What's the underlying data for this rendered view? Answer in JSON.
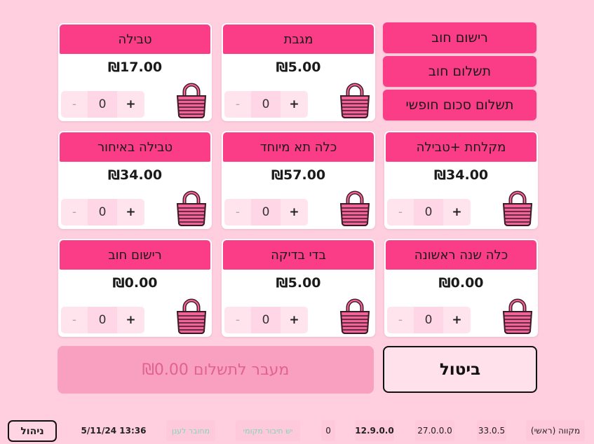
{
  "actions": [
    {
      "label": "רישום חוב"
    },
    {
      "label": "תשלום חוב"
    },
    {
      "label": "תשלום סכום חופשי"
    }
  ],
  "products": [
    {
      "title": "טבילה",
      "price": "₪17.00",
      "qty": "0"
    },
    {
      "title": "מגבת",
      "price": "₪5.00",
      "qty": "0"
    },
    {
      "title": "טבילה באיחור",
      "price": "₪34.00",
      "qty": "0"
    },
    {
      "title": "כלה תא מיוחד",
      "price": "₪57.00",
      "qty": "0"
    },
    {
      "title": "מקלחת +טבילה",
      "price": "₪34.00",
      "qty": "0"
    },
    {
      "title": "רישום חוב",
      "price": "₪0.00",
      "qty": "0"
    },
    {
      "title": "בדי בדיקה",
      "price": "₪5.00",
      "qty": "0"
    },
    {
      "title": "כלה שנה ראשונה",
      "price": "₪0.00",
      "qty": "0"
    }
  ],
  "stepper": {
    "minus": "-",
    "plus": "+"
  },
  "pay_button": "מעבר לתשלום ₪0.00",
  "cancel_button": "ביטול",
  "status": {
    "manage": "ניהול",
    "datetime": "13:36 5/11/24",
    "cloud": "מחובר לענן",
    "local": "יש חיבור מקומי",
    "count": "0",
    "version": "12.9.0.0",
    "ver2": "27.0.0.0",
    "ver3": "33.0.5",
    "location": "מקווה (ראשי)"
  },
  "colors": {
    "background": "#ffcfe0",
    "accent": "#fa3d86",
    "pay_disabled": "#f99fc0",
    "cloud_text": "#7ed8b9",
    "local_text": "#7ed8b9"
  },
  "icons": {
    "product": "shopping-basket-icon"
  }
}
